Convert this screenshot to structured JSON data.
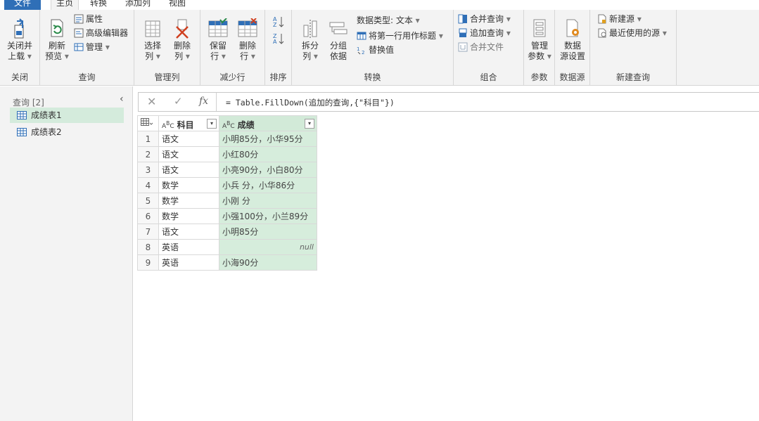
{
  "menu": {
    "tabs": [
      "文件",
      "主页",
      "转换",
      "添加列",
      "视图"
    ]
  },
  "ribbon": {
    "close": {
      "button": "关闭并\n上载",
      "group": "关闭"
    },
    "query": {
      "refresh": "刷新\n预览",
      "properties": "属性",
      "advanced_editor": "高级编辑器",
      "manage": "管理",
      "group": "查询"
    },
    "manage_cols": {
      "select": "选择\n列",
      "remove": "删除\n列",
      "group": "管理列"
    },
    "reduce_rows": {
      "keep": "保留\n行",
      "remove": "删除\n行",
      "group": "减少行"
    },
    "sort": {
      "group": "排序"
    },
    "transform": {
      "split": "拆分\n列",
      "group_by": "分组\n依据",
      "data_type": "数据类型: 文本",
      "first_row_header": "将第一行用作标题",
      "replace": "替换值",
      "group": "转换"
    },
    "combine": {
      "merge": "合并查询",
      "append": "追加查询",
      "combine_files": "合并文件",
      "group": "组合"
    },
    "params": {
      "manage": "管理\n参数",
      "group": "参数"
    },
    "datasource": {
      "settings": "数据\n源设置",
      "group": "数据源"
    },
    "new_query": {
      "new_source": "新建源",
      "recent": "最近使用的源",
      "group": "新建查询"
    }
  },
  "queries": {
    "title": "查询 [2]",
    "items": [
      "成绩表1",
      "成绩表2"
    ]
  },
  "formula": "= Table.FillDown(追加的查询,{\"科目\"})",
  "table": {
    "headers": [
      "科目",
      "成绩"
    ],
    "rows": [
      [
        "1",
        "语文",
        "小明85分，小华95分"
      ],
      [
        "2",
        "语文",
        "小红80分"
      ],
      [
        "3",
        "语文",
        "小亮90分，小白80分"
      ],
      [
        "4",
        "数学",
        "小兵 分，小华86分"
      ],
      [
        "5",
        "数学",
        "小刚 分"
      ],
      [
        "6",
        "数学",
        "小强100分，小兰89分"
      ],
      [
        "7",
        "语文",
        "小明85分"
      ],
      [
        "8",
        "英语",
        "null"
      ],
      [
        "9",
        "英语",
        "小海90分"
      ]
    ]
  }
}
